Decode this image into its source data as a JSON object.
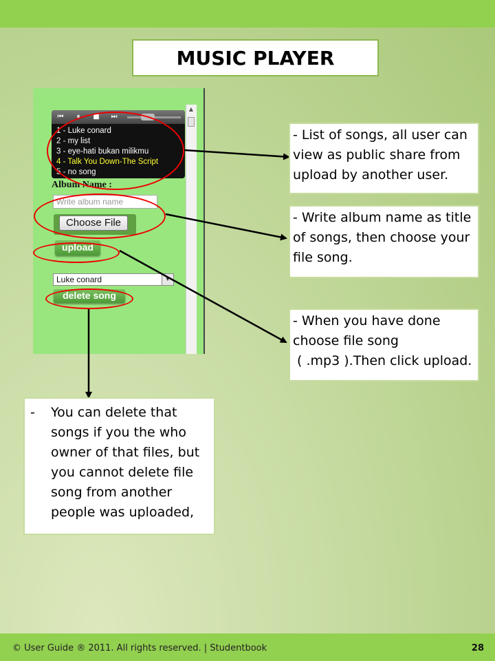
{
  "title": "MUSIC PLAYER",
  "player": {
    "controls": [
      "⏮",
      "⏸",
      "■",
      "⏭"
    ],
    "songs": [
      "1 - Luke conard",
      "2 - my list",
      "3 - eye-hati bukan milikmu",
      "4 - Talk You Down-The Script",
      "5 - no song"
    ],
    "active_song_index": 3,
    "active_song_color": "#ffff33"
  },
  "form": {
    "album_label": "Album Name :",
    "album_placeholder": "Write album name",
    "choose_file_label": "Choose File",
    "upload_label": "upload",
    "select_value": "Luke conard",
    "delete_label": "delete song"
  },
  "callouts": {
    "list": "- List of songs, all user can view as public share from upload by another user.",
    "album": "- Write album name as title of songs, then choose your file song.",
    "upload": "- When you have done choose file song\n ( .mp3 ).Then click upload.",
    "delete_dash": "-",
    "delete": "You can delete that songs if you the who owner of that files, but you cannot delete file song from another people was uploaded,"
  },
  "footer": {
    "text": "© User Guide ® 2011. All rights reserved. | Studentbook",
    "page": "28"
  },
  "colors": {
    "bar_green": "#92d050",
    "panel_green": "#99e67f",
    "highlight_red": "#e00000"
  }
}
